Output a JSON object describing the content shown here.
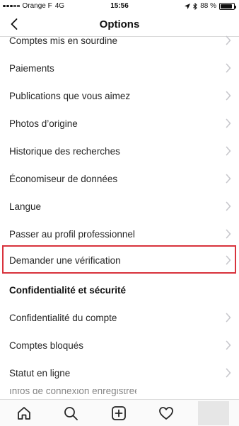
{
  "status_bar": {
    "carrier": "Orange F",
    "network": "4G",
    "time": "15:56",
    "battery_text": "88 %",
    "battery_level": 0.88
  },
  "header": {
    "title": "Options"
  },
  "menu": {
    "items": [
      {
        "label": "Comptes mis en sourdine"
      },
      {
        "label": "Paiements"
      },
      {
        "label": "Publications que vous aimez"
      },
      {
        "label": "Photos d’origine"
      },
      {
        "label": "Historique des recherches"
      },
      {
        "label": "Économiseur de données"
      },
      {
        "label": "Langue"
      },
      {
        "label": "Passer au profil professionnel"
      },
      {
        "label": "Demander une vérification"
      }
    ],
    "section_title": "Confidentialité et sécurité",
    "section_items": [
      {
        "label": "Confidentialité du compte"
      },
      {
        "label": "Comptes bloqués"
      },
      {
        "label": "Statut en ligne"
      }
    ],
    "partial_item": "Infos de connexion enregistrées"
  },
  "colors": {
    "highlight": "#d8323c",
    "chevron": "#c7c7cc",
    "divider": "#dbdbdb"
  },
  "tabs": [
    "home-icon",
    "search-icon",
    "add-icon",
    "heart-icon",
    "profile-avatar"
  ]
}
